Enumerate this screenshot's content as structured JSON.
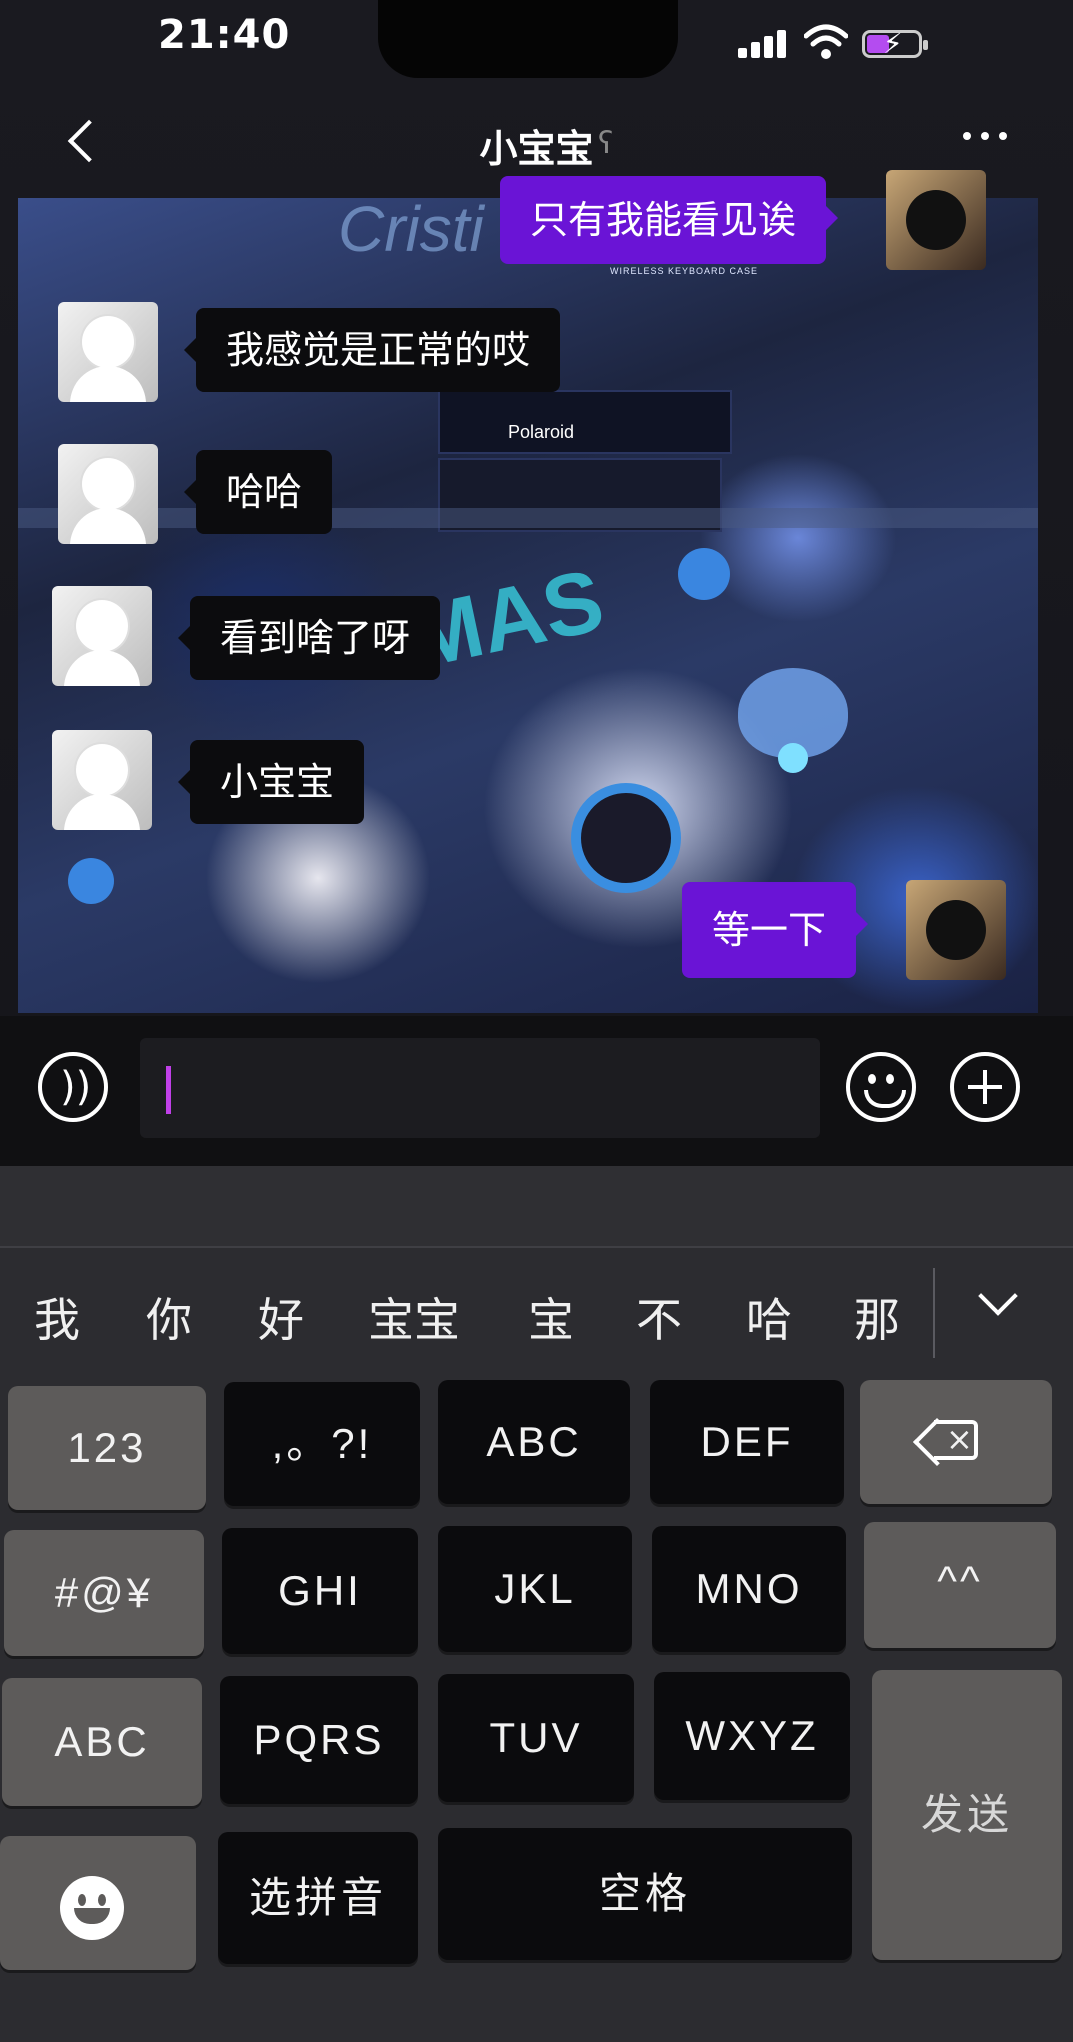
{
  "status": {
    "time": "21:40"
  },
  "header": {
    "title": "小宝宝"
  },
  "messages": [
    {
      "side": "out",
      "text": "只有我能看见诶"
    },
    {
      "side": "in",
      "text": "我感觉是正常的哎"
    },
    {
      "side": "in",
      "text": "哈哈"
    },
    {
      "side": "in",
      "text": "看到啥了呀"
    },
    {
      "side": "in",
      "text": "小宝宝"
    },
    {
      "side": "out",
      "text": "等一下"
    }
  ],
  "background": {
    "texts": [
      "WIRELESS KEYBOARD CASE",
      "Polaroid",
      "MAS",
      "Cristi"
    ]
  },
  "input": {
    "value": ""
  },
  "keyboard": {
    "candidates": [
      "我",
      "你",
      "好",
      "宝宝",
      "宝",
      "不",
      "哈",
      "那"
    ],
    "keys": {
      "num": "123",
      "punct": ",。?!",
      "abc": "ABC",
      "def": "DEF",
      "sym": "#@¥",
      "ghi": "GHI",
      "jkl": "JKL",
      "mno": "MNO",
      "kaomoji": "^^",
      "abc_switch": "ABC",
      "pqrs": "PQRS",
      "tuv": "TUV",
      "wxyz": "WXYZ",
      "send": "发送",
      "pinyin": "选拼音",
      "space": "空格"
    }
  },
  "colors": {
    "outgoing_bubble": "#6a14d6",
    "incoming_bubble": "#0c0c0e",
    "caret": "#c040e8",
    "battery": "#b44cf0"
  }
}
